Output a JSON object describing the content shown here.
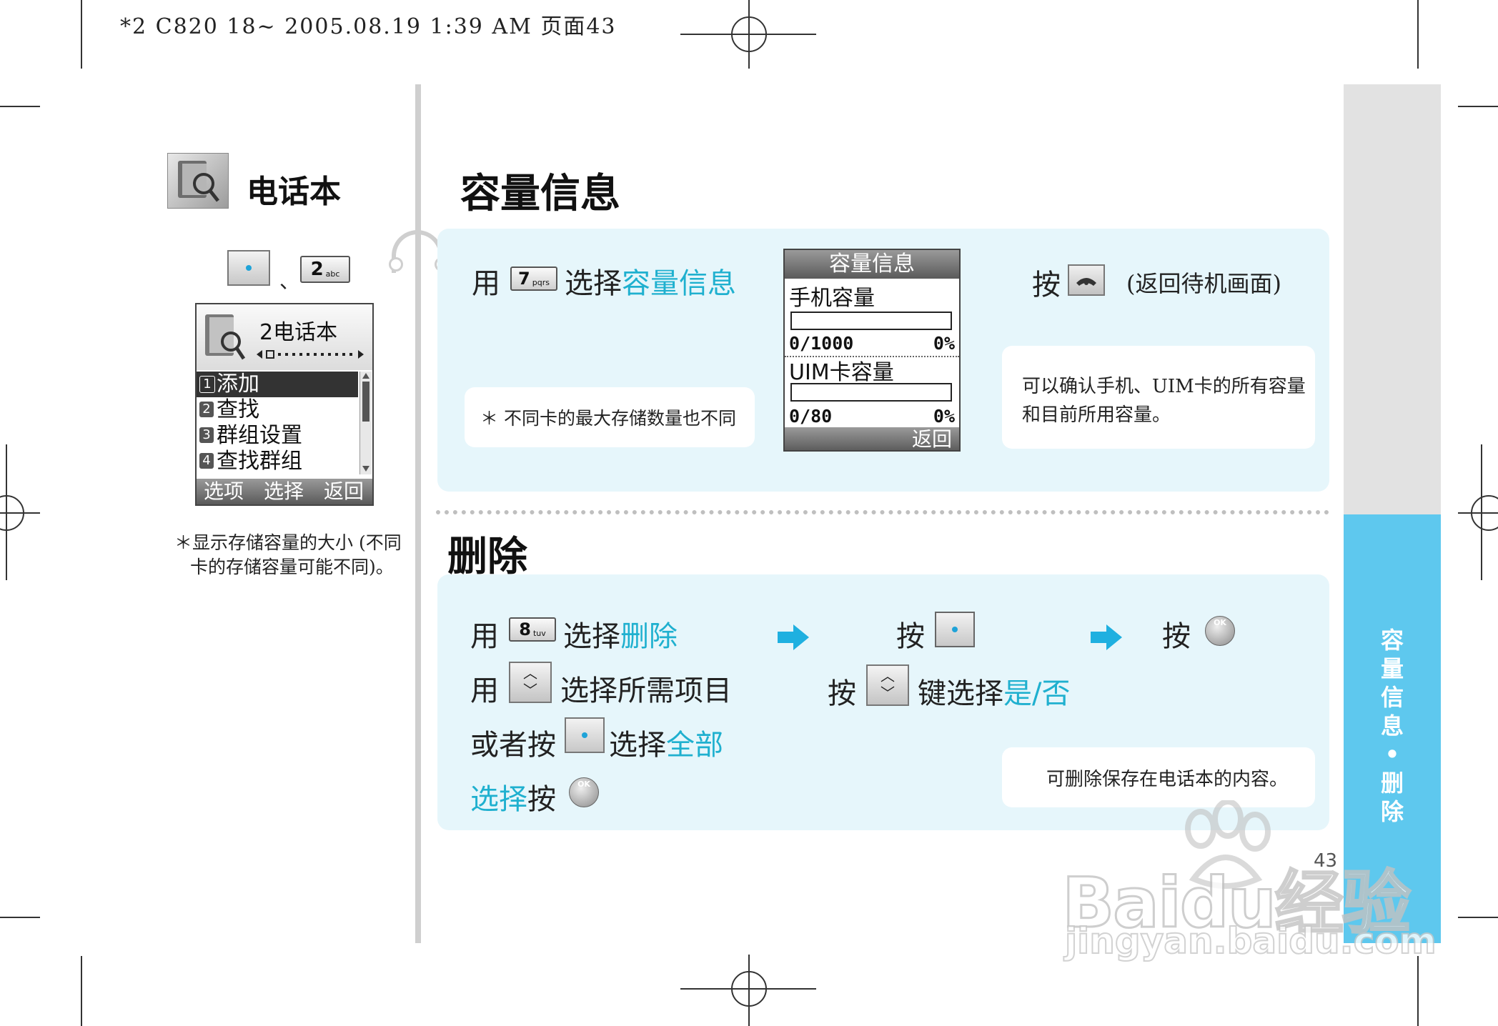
{
  "print_header": "*2 C820 18~ 2005.08.19 1:39 AM 页面43",
  "left": {
    "section_title": "电话本",
    "key_separator": "、",
    "key2": {
      "digit": "2",
      "letters": "abc"
    },
    "phone_menu": {
      "title": "2电话本",
      "items": [
        {
          "num": "1",
          "label": "添加"
        },
        {
          "num": "2",
          "label": "查找"
        },
        {
          "num": "3",
          "label": "群组设置"
        },
        {
          "num": "4",
          "label": "查找群组"
        }
      ],
      "softkeys": [
        "选项",
        "选择",
        "返回"
      ]
    },
    "footnote_line1": "＊显示存储容量的大小 (不同",
    "footnote_line2": "卡的存储容量可能不同)。"
  },
  "capacity": {
    "title": "容量信息",
    "use": "用",
    "key7": {
      "digit": "7",
      "letters": "pqrs"
    },
    "select_text": "选择",
    "select_target": "容量信息",
    "press": "按",
    "return_text": "(返回待机画面)",
    "note_card": "＊  不同卡的最大存储数量也不同",
    "desc_line1": "可以确认手机、UIM卡的所有容量",
    "desc_line2": "和目前所用容量。",
    "screen": {
      "title": "容量信息",
      "phone_label": "手机容量",
      "phone_count": "0/1000",
      "phone_percent": "0%",
      "phone_fill": 0,
      "uim_label": "UIM卡容量",
      "uim_count": "0/80",
      "uim_percent": "0%",
      "uim_fill": 0,
      "softkey": "返回"
    }
  },
  "delete": {
    "title": "删除",
    "use1": "用",
    "key8": {
      "digit": "8",
      "letters": "tuv"
    },
    "select1": "选择",
    "select1_target": "删除",
    "use2": "用",
    "select2": "选择所需项目",
    "or_press": "或者按",
    "select3": "选择",
    "select3_target": "全部",
    "select4": "选择",
    "press4": "按",
    "press_a": "按",
    "press_b": "按",
    "press_c": "按",
    "key_select": "键选择",
    "yes_no": "是/否",
    "ok_label": "OK",
    "desc": "可删除保存在电话本的内容。"
  },
  "side_tab": {
    "chars": [
      "容",
      "量",
      "信",
      "息",
      "•",
      "删",
      "除"
    ]
  },
  "page_number": "43",
  "watermark": {
    "brand": "Baidu经验",
    "url": "jingyan.baidu.com"
  },
  "colors": {
    "accent": "#1fb0cf",
    "tab_blue": "#5ec8ee",
    "tab_gray": "#e2e2e2",
    "panel": "#e6f6fb"
  }
}
